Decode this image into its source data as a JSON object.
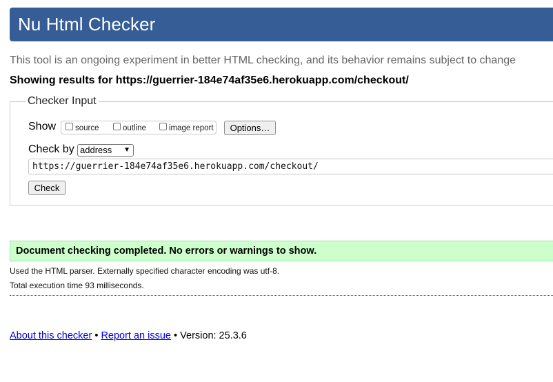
{
  "header": {
    "title": "Nu Html Checker"
  },
  "tagline": "This tool is an ongoing experiment in better HTML checking, and its behavior remains subject to change",
  "showing": "Showing results for https://guerrier-184e74af35e6.herokuapp.com/checkout/",
  "checker_input": {
    "legend": "Checker Input",
    "show_label": "Show",
    "show_options": [
      {
        "label": "source",
        "checked": false
      },
      {
        "label": "outline",
        "checked": false
      },
      {
        "label": "image report",
        "checked": false
      }
    ],
    "options_button": "Options…",
    "check_by_label": "Check by",
    "check_by_selected": "address",
    "url_value": "https://guerrier-184e74af35e6.herokuapp.com/checkout/",
    "check_button": "Check"
  },
  "result": {
    "message": "Document checking completed. No errors or warnings to show.",
    "parser_info": "Used the HTML parser. Externally specified character encoding was utf-8.",
    "execution_time": "Total execution time 93 milliseconds."
  },
  "footer": {
    "about_link": "About this checker",
    "separator": "•",
    "report_link": "Report an issue",
    "version": "Version: 25.3.6"
  },
  "colors": {
    "header_bg": "#365d95",
    "success_bg": "#ccffcc",
    "link": "#0000ee"
  }
}
